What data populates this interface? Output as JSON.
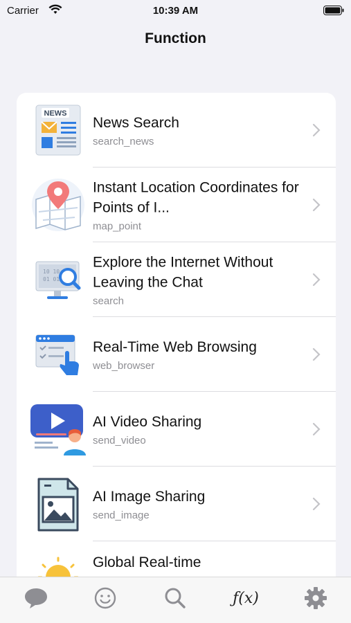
{
  "status": {
    "carrier": "Carrier",
    "time": "10:39 AM",
    "icons": [
      "wifi-icon",
      "battery-icon"
    ]
  },
  "nav": {
    "title": "Function"
  },
  "items": [
    {
      "title": "News Search",
      "subtitle": "search_news",
      "icon": "newspaper-icon"
    },
    {
      "title": "Instant Location Coordinates for Points of I...",
      "subtitle": "map_point",
      "icon": "map-pin-icon"
    },
    {
      "title": "Explore the Internet Without Leaving the Chat",
      "subtitle": "search",
      "icon": "monitor-search-icon"
    },
    {
      "title": "Real-Time Web Browsing",
      "subtitle": "web_browser",
      "icon": "browser-click-icon"
    },
    {
      "title": "AI Video Sharing",
      "subtitle": "send_video",
      "icon": "video-play-icon"
    },
    {
      "title": "AI Image Sharing",
      "subtitle": "send_image",
      "icon": "image-file-icon"
    },
    {
      "title": "Global Real-time",
      "subtitle": "",
      "icon": "sun-icon"
    }
  ],
  "tabs": [
    {
      "name": "chat",
      "icon": "chat-bubble-icon"
    },
    {
      "name": "emoji",
      "icon": "smiley-icon"
    },
    {
      "name": "search",
      "icon": "magnifier-icon"
    },
    {
      "name": "function",
      "label": "ƒ(x)",
      "icon": "function-icon"
    },
    {
      "name": "settings",
      "icon": "gear-icon"
    }
  ],
  "colors": {
    "background": "#f2f2f7",
    "accent_blue": "#2f7de1",
    "tab_icon": "#8e8e93"
  }
}
